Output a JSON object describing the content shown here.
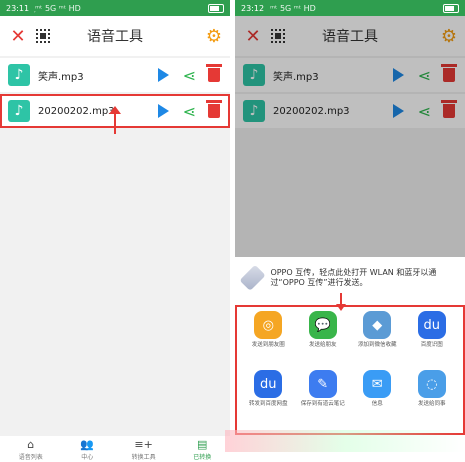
{
  "left": {
    "status": {
      "time": "23:11",
      "signal": "᷊ᵐᵗ 5G ᵐᵗ HD",
      "battery": "⌁"
    },
    "toolbar": {
      "title": "语音工具"
    },
    "files": [
      {
        "name": "笑声.mp3"
      },
      {
        "name": "20200202.mp3"
      }
    ],
    "nav": [
      {
        "label": "语音列表",
        "icon": "⌂"
      },
      {
        "label": "中心",
        "icon": "👥"
      },
      {
        "label": "转换工具",
        "icon": "≡+"
      },
      {
        "label": "已转换",
        "icon": "▤"
      }
    ]
  },
  "right": {
    "status": {
      "time": "23:12",
      "signal": "ᵐᵗ 5G ᵐᵗ HD",
      "battery": "⌁"
    },
    "toolbar": {
      "title": "语音工具"
    },
    "files": [
      {
        "name": "笑声.mp3"
      },
      {
        "name": "20200202.mp3"
      }
    ],
    "oppo": {
      "text": "OPPO 互传，轻点此处打开 WLAN 和蓝牙以通过“OPPO 互传”进行发送。"
    },
    "share_targets": [
      {
        "label": "发送到朋友圈",
        "icon": "camera-aperture-icon",
        "color": "#f5a623"
      },
      {
        "label": "发送给朋友",
        "icon": "wechat-icon",
        "color": "#39b54a"
      },
      {
        "label": "添加到微信收藏",
        "icon": "cube-icon",
        "color": "#5b9bd5"
      },
      {
        "label": "百度识图",
        "icon": "baidu-icon",
        "color": "#2b6de5"
      },
      {
        "label": "转发到百度网盘",
        "icon": "baidu-netdisk-icon",
        "color": "#2b6de5"
      },
      {
        "label": "保存到有道云笔记",
        "icon": "pen-icon",
        "color": "#3d7cf0"
      },
      {
        "label": "信息",
        "icon": "message-icon",
        "color": "#3a9cf5"
      },
      {
        "label": "发送给同事",
        "icon": "chat-icon",
        "color": "#4a9ee8"
      }
    ]
  }
}
